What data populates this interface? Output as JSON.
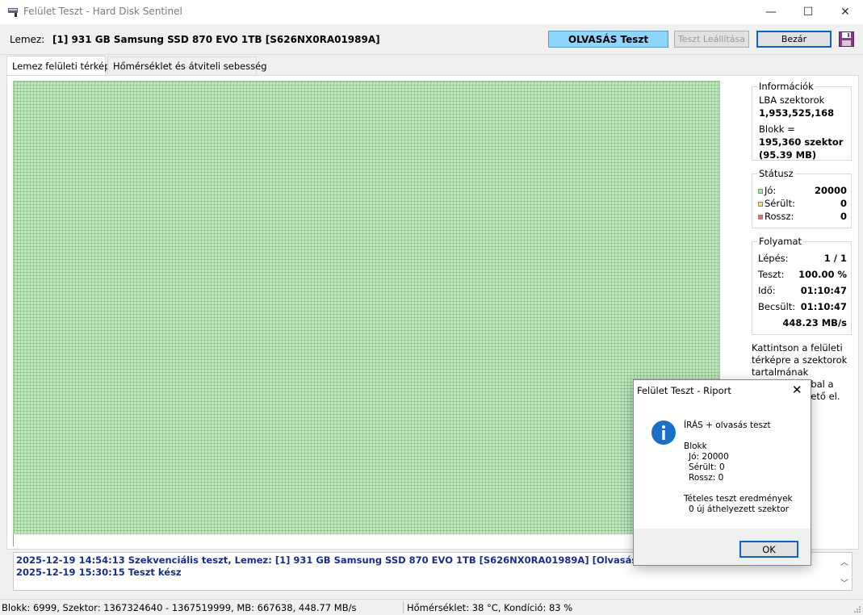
{
  "window": {
    "title": "Felület Teszt - Hard Disk Sentinel",
    "minimize": "—",
    "maximize": "☐",
    "close": "✕"
  },
  "toolbar": {
    "disk_label": "Lemez:",
    "disk_name": "[1] 931 GB  Samsung SSD 870 EVO 1TB [S626NX0RA01989A]",
    "read_test_button": "OLVASÁS Teszt",
    "stop_test_button": "Teszt Leállítása",
    "close_button": "Bezár"
  },
  "tabs": [
    {
      "label": "Lemez felületi térkép",
      "active": true
    },
    {
      "label": "Hőmérséklet és átviteli sebesség",
      "active": false
    }
  ],
  "info": {
    "title": "Információk",
    "lba_label": "LBA szektorok",
    "lba_value": "1,953,525,168",
    "block_label": "Blokk =",
    "block_value": "195,360 szektor",
    "block_size": "(95.39 MB)"
  },
  "status": {
    "title": "Státusz",
    "good_label": "Jó:",
    "good_value": "20000",
    "damaged_label": "Sérült:",
    "damaged_value": "0",
    "bad_label": "Rossz:",
    "bad_value": "0",
    "colors": {
      "good": "#a8e6a8",
      "damaged": "#f5e08a",
      "bad": "#e07070"
    }
  },
  "progress": {
    "title": "Folyamat",
    "step_label": "Lépés:",
    "step_value": "1 / 1",
    "test_label": "Teszt:",
    "test_value": "100.00 %",
    "time_label": "Idő:",
    "time_value": "01:10:47",
    "estimated_label": "Becsült:",
    "estimated_value": "01:10:47",
    "speed_value": "448.23 MB/s"
  },
  "hint": {
    "line1": "Kattintson a felületi",
    "line2": "térképre a szektorok",
    "line3": "tartalmának",
    "line4": "bbal a",
    "line5": "hető el."
  },
  "log": [
    "2025-12-19  14:54:13   Szekvenciális teszt, Lemez: [1] 931 GB  Samsung SSD 870 EVO 1TB [S626NX0RA01989A] [Olvasás]",
    "2025-12-19  15:30:15   Teszt kész"
  ],
  "statusbar": {
    "left": "Blokk: 6999, Szektor: 1367324640 - 1367519999, MB: 667638, 448.77 MB/s",
    "right": "Hőmérséklet: 38  °C,  Kondíció: 83 %"
  },
  "dialog": {
    "title": "Felület Teszt - Riport",
    "heading": "ÍRÁS + olvasás teszt",
    "block_label": "Blokk",
    "good_line": "Jó: 20000",
    "damaged_line": "Sérült: 0",
    "bad_line": "Rossz: 0",
    "results_label": "Tételes teszt eredmények",
    "relocated_line": "0 új áthelyezett szektor",
    "ok_button": "OK",
    "close": "✕"
  }
}
